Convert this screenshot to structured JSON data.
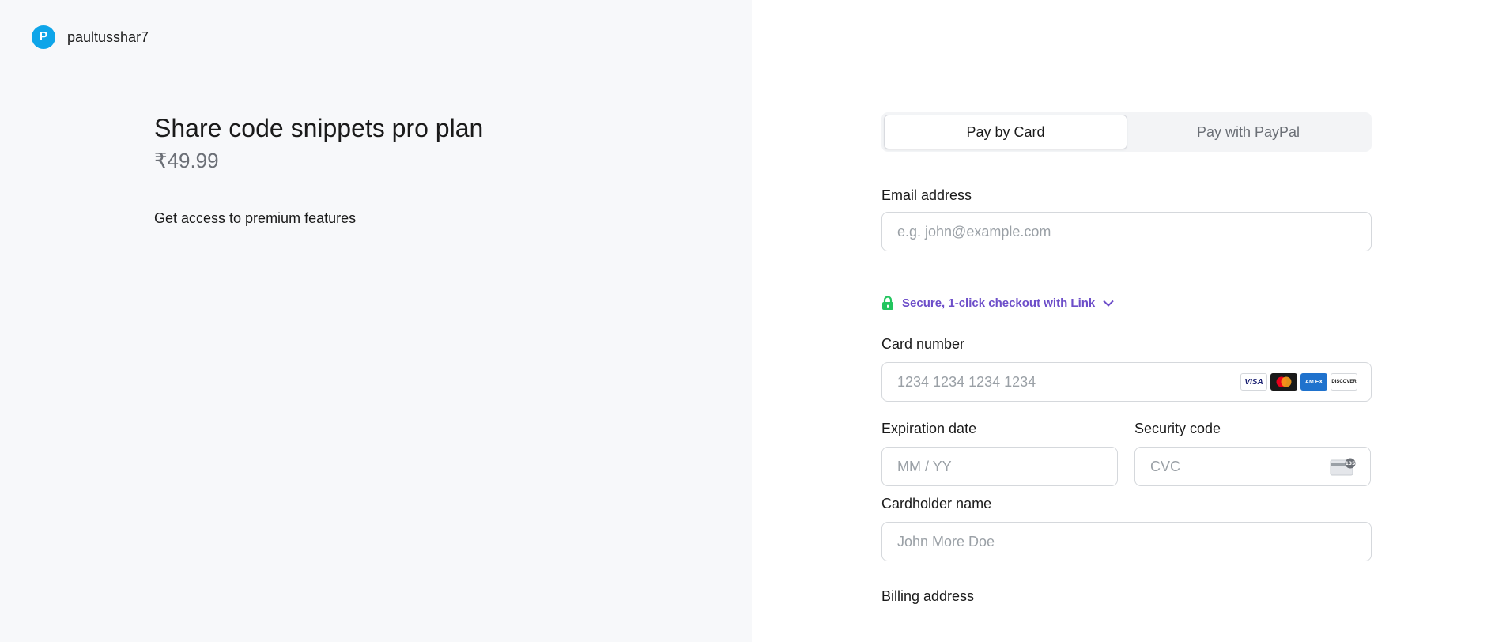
{
  "merchant": {
    "avatar_letter": "P",
    "name": "paultusshar7"
  },
  "product": {
    "title": "Share code snippets pro plan",
    "price": "₹49.99",
    "description": "Get access to premium features"
  },
  "payment_tabs": [
    {
      "label": "Pay by Card",
      "active": true
    },
    {
      "label": "Pay with PayPal",
      "active": false
    }
  ],
  "email": {
    "label": "Email address",
    "placeholder": "e.g. john@example.com",
    "value": ""
  },
  "link_checkout": {
    "text": "Secure, 1-click checkout with Link"
  },
  "card_number": {
    "label": "Card number",
    "placeholder": "1234 1234 1234 1234",
    "brands": [
      "visa-icon",
      "mastercard-icon",
      "amex-icon",
      "discover-icon"
    ],
    "brand_text": {
      "visa": "VISA",
      "amex": "AM EX",
      "discover": "DISCOVER"
    }
  },
  "expiration": {
    "label": "Expiration date",
    "placeholder": "MM / YY"
  },
  "security_code": {
    "label": "Security code",
    "placeholder": "CVC",
    "icon_text": "135"
  },
  "cardholder": {
    "label": "Cardholder name",
    "placeholder": "John More Doe"
  },
  "billing": {
    "label": "Billing address"
  },
  "colors": {
    "left_bg": "#f7f8fa",
    "avatar": "#0ea5e9",
    "link_purple": "#6d4ec9",
    "lock_green": "#22c55e"
  }
}
